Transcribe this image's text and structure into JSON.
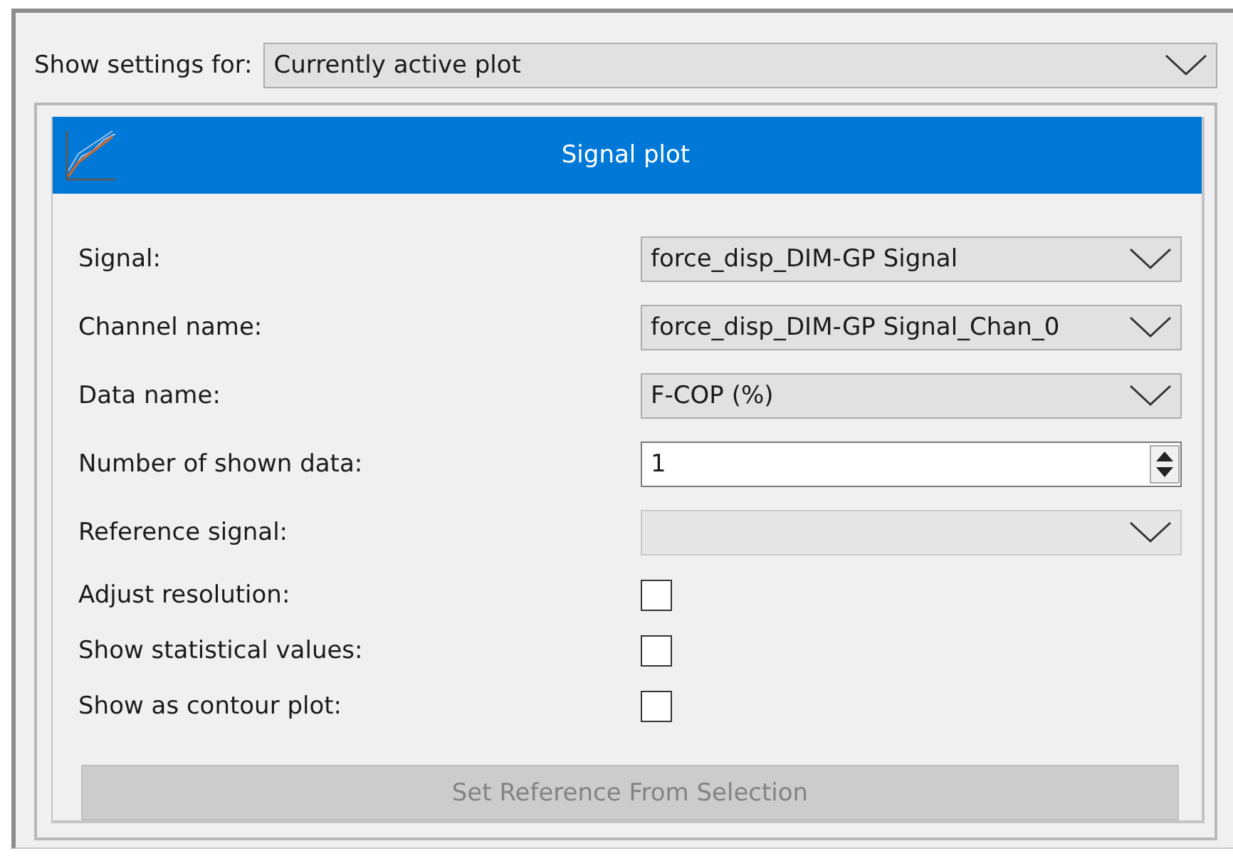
{
  "show_settings": {
    "label": "Show settings for:",
    "value": "Currently active plot"
  },
  "panel": {
    "title": "Signal plot",
    "rows": [
      {
        "kind": "dropdown",
        "label": "Signal:",
        "value": "force_disp_DIM-GP Signal",
        "disabled": false
      },
      {
        "kind": "dropdown",
        "label": "Channel name:",
        "value": "force_disp_DIM-GP Signal_Chan_0",
        "disabled": false
      },
      {
        "kind": "dropdown",
        "label": "Data name:",
        "value": "F-COP (%)",
        "disabled": false
      },
      {
        "kind": "spin",
        "label": "Number of shown data:",
        "value": "1"
      },
      {
        "kind": "dropdown",
        "label": "Reference signal:",
        "disabled": true
      },
      {
        "kind": "checkbox",
        "label": "Adjust resolution:",
        "checked": false
      },
      {
        "kind": "checkbox",
        "label": "Show statistical values:",
        "checked": false
      },
      {
        "kind": "checkbox",
        "label": "Show as contour plot:",
        "checked": false
      }
    ],
    "button": {
      "label": "Set Reference From Selection",
      "disabled": true
    }
  }
}
